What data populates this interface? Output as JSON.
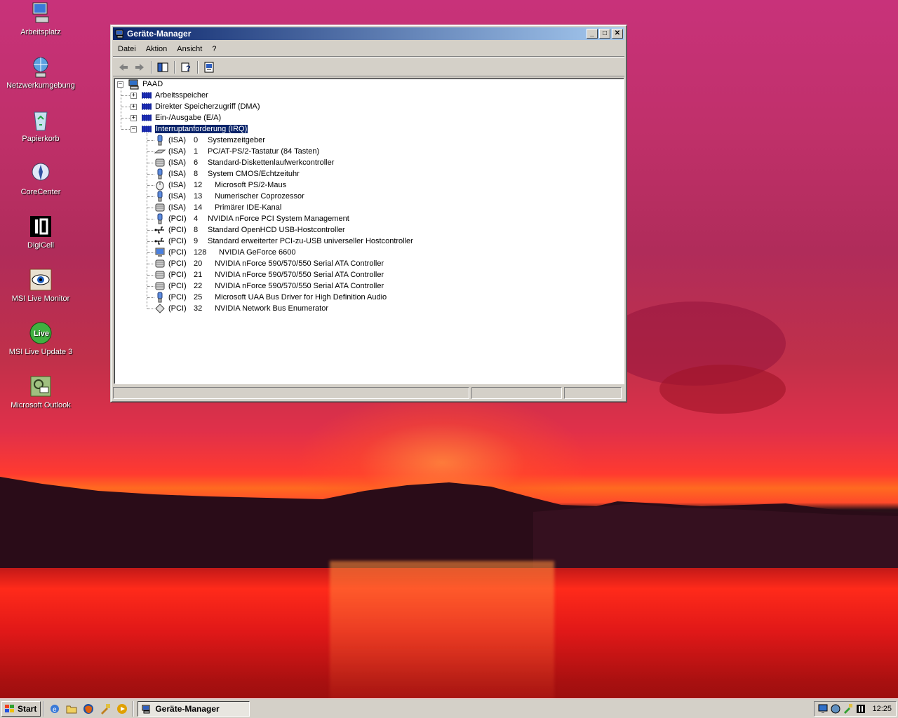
{
  "desktop": {
    "icons": [
      {
        "label": "Arbeitsplatz",
        "icon": "computer-icon"
      },
      {
        "label": "Netzwerkumgebung",
        "icon": "network-icon"
      },
      {
        "label": "Papierkorb",
        "icon": "recycle-bin-icon"
      },
      {
        "label": "CoreCenter",
        "icon": "corecenter-icon"
      },
      {
        "label": "DigiCell",
        "icon": "digicell-icon"
      },
      {
        "label": "MSI Live Monitor",
        "icon": "eye-icon"
      },
      {
        "label": "MSI Live Update 3",
        "icon": "live-update-icon"
      },
      {
        "label": "Microsoft Outlook",
        "icon": "outlook-icon"
      }
    ]
  },
  "window": {
    "title": "Geräte-Manager",
    "controls": {
      "minimize": "_",
      "maximize": "□",
      "close": "✕"
    },
    "menu": [
      "Datei",
      "Aktion",
      "Ansicht",
      "?"
    ],
    "toolbar": [
      "back-arrow-icon",
      "forward-arrow-icon",
      "show-hide-tree-icon",
      "properties-help-icon",
      "scan-hardware-icon"
    ]
  },
  "tree": {
    "root": "PAAD",
    "categories": [
      {
        "label": "Arbeitsspeicher",
        "expander": "+"
      },
      {
        "label": "Direkter Speicherzugriff (DMA)",
        "expander": "+"
      },
      {
        "label": "Ein-/Ausgabe (E/A)",
        "expander": "+"
      },
      {
        "label": "Interruptanforderung (IRQ)",
        "expander": "−",
        "selected": true
      }
    ],
    "root_expander": "−",
    "irq_items": [
      {
        "bus": "(ISA)",
        "irq": "0",
        "name": "Systemzeitgeber",
        "icon": "system-device-icon"
      },
      {
        "bus": "(ISA)",
        "irq": "1",
        "name": "PC/AT-PS/2-Tastatur (84 Tasten)",
        "icon": "keyboard-icon"
      },
      {
        "bus": "(ISA)",
        "irq": "6",
        "name": "Standard-Diskettenlaufwerkcontroller",
        "icon": "disk-controller-icon"
      },
      {
        "bus": "(ISA)",
        "irq": "8",
        "name": "System CMOS/Echtzeituhr",
        "icon": "system-device-icon"
      },
      {
        "bus": "(ISA)",
        "irq": "12",
        "name": "Microsoft PS/2-Maus",
        "icon": "mouse-icon"
      },
      {
        "bus": "(ISA)",
        "irq": "13",
        "name": "Numerischer Coprozessor",
        "icon": "system-device-icon"
      },
      {
        "bus": "(ISA)",
        "irq": "14",
        "name": "Primärer IDE-Kanal",
        "icon": "disk-controller-icon"
      },
      {
        "bus": "(PCI)",
        "irq": "4",
        "name": "NVIDIA nForce PCI System Management",
        "icon": "system-device-icon"
      },
      {
        "bus": "(PCI)",
        "irq": "8",
        "name": "Standard OpenHCD USB-Hostcontroller",
        "icon": "usb-icon"
      },
      {
        "bus": "(PCI)",
        "irq": "9",
        "name": "Standard erweiterter PCI-zu-USB universeller Hostcontroller",
        "icon": "usb-icon"
      },
      {
        "bus": "(PCI)",
        "irq": "128",
        "name": "NVIDIA GeForce 6600",
        "icon": "display-adapter-icon"
      },
      {
        "bus": "(PCI)",
        "irq": "20",
        "name": "NVIDIA nForce 590/570/550 Serial ATA Controller",
        "icon": "disk-controller-icon"
      },
      {
        "bus": "(PCI)",
        "irq": "21",
        "name": "NVIDIA nForce 590/570/550 Serial ATA Controller",
        "icon": "disk-controller-icon"
      },
      {
        "bus": "(PCI)",
        "irq": "22",
        "name": "NVIDIA nForce 590/570/550 Serial ATA Controller",
        "icon": "disk-controller-icon"
      },
      {
        "bus": "(PCI)",
        "irq": "25",
        "name": "Microsoft UAA Bus Driver for High Definition Audio",
        "icon": "system-device-icon"
      },
      {
        "bus": "(PCI)",
        "irq": "32",
        "name": "NVIDIA Network Bus Enumerator",
        "icon": "network-enumerator-icon"
      }
    ]
  },
  "taskbar": {
    "start_label": "Start",
    "quick_launch": [
      "ie-icon",
      "explorer-icon",
      "firefox-icon",
      "tool-icon",
      "media-icon"
    ],
    "task_title": "Geräte-Manager",
    "tray_icons": [
      "monitor-tray-icon",
      "network-tray-icon",
      "tool-tray-icon",
      "digicell-tray-icon"
    ],
    "clock": "12:25"
  },
  "colors": {
    "selection": "#0a246a",
    "titlebar_start": "#0a246a",
    "titlebar_end": "#a6caf0",
    "face": "#d4d0c8"
  }
}
